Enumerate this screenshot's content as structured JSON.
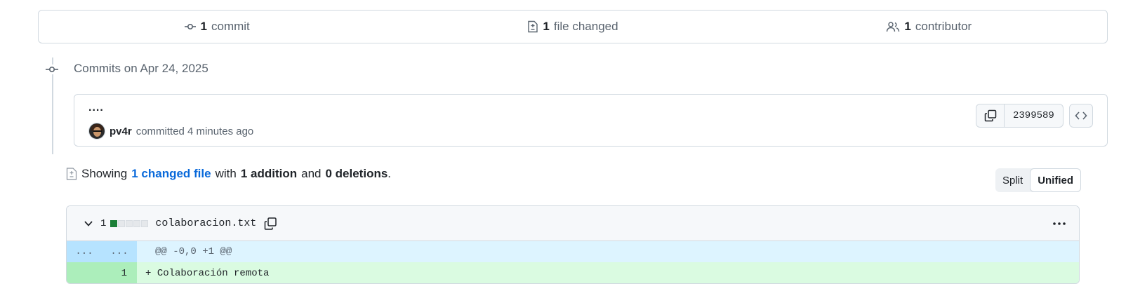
{
  "summary": {
    "commits": {
      "count": "1",
      "label": "commit"
    },
    "files": {
      "count": "1",
      "label": "file changed"
    },
    "contributors": {
      "count": "1",
      "label": "contributor"
    }
  },
  "timeline": {
    "date_heading": "Commits on Apr 24, 2025"
  },
  "commit": {
    "title": "....",
    "author": "pv4r",
    "action": "committed 4 minutes ago",
    "sha": "2399589"
  },
  "showing": {
    "prefix": "Showing",
    "files_link": "1 changed file",
    "with": "with",
    "additions": "1 addition",
    "and": "and",
    "deletions": "0 deletions",
    "period": "."
  },
  "view_toggle": {
    "split": "Split",
    "unified": "Unified",
    "selected": "Unified"
  },
  "file": {
    "change_count": "1",
    "filename": "colaboracion.txt",
    "diffstat": {
      "added": 1,
      "deleted": 0,
      "neutral": 4
    },
    "hunk": {
      "old_num": "...",
      "new_num": "...",
      "header": "@@ -0,0 +1 @@"
    },
    "lines": [
      {
        "old_num": "",
        "new_num": "1",
        "marker": "+",
        "text": "Colaboración remota"
      }
    ]
  },
  "colors": {
    "accent_link": "#0969da",
    "added_bg": "#dafbe1",
    "added_num_bg": "#aceebb",
    "hunk_bg": "#ddf4ff",
    "hunk_num_bg": "#b6e3ff",
    "diffstat_add": "#1a7f37"
  },
  "icons": [
    "commit-icon",
    "file-diff-icon",
    "people-icon",
    "commit-node-icon",
    "copy-icon",
    "code-icon",
    "chevron-down-icon",
    "kebab-horizontal-icon"
  ]
}
